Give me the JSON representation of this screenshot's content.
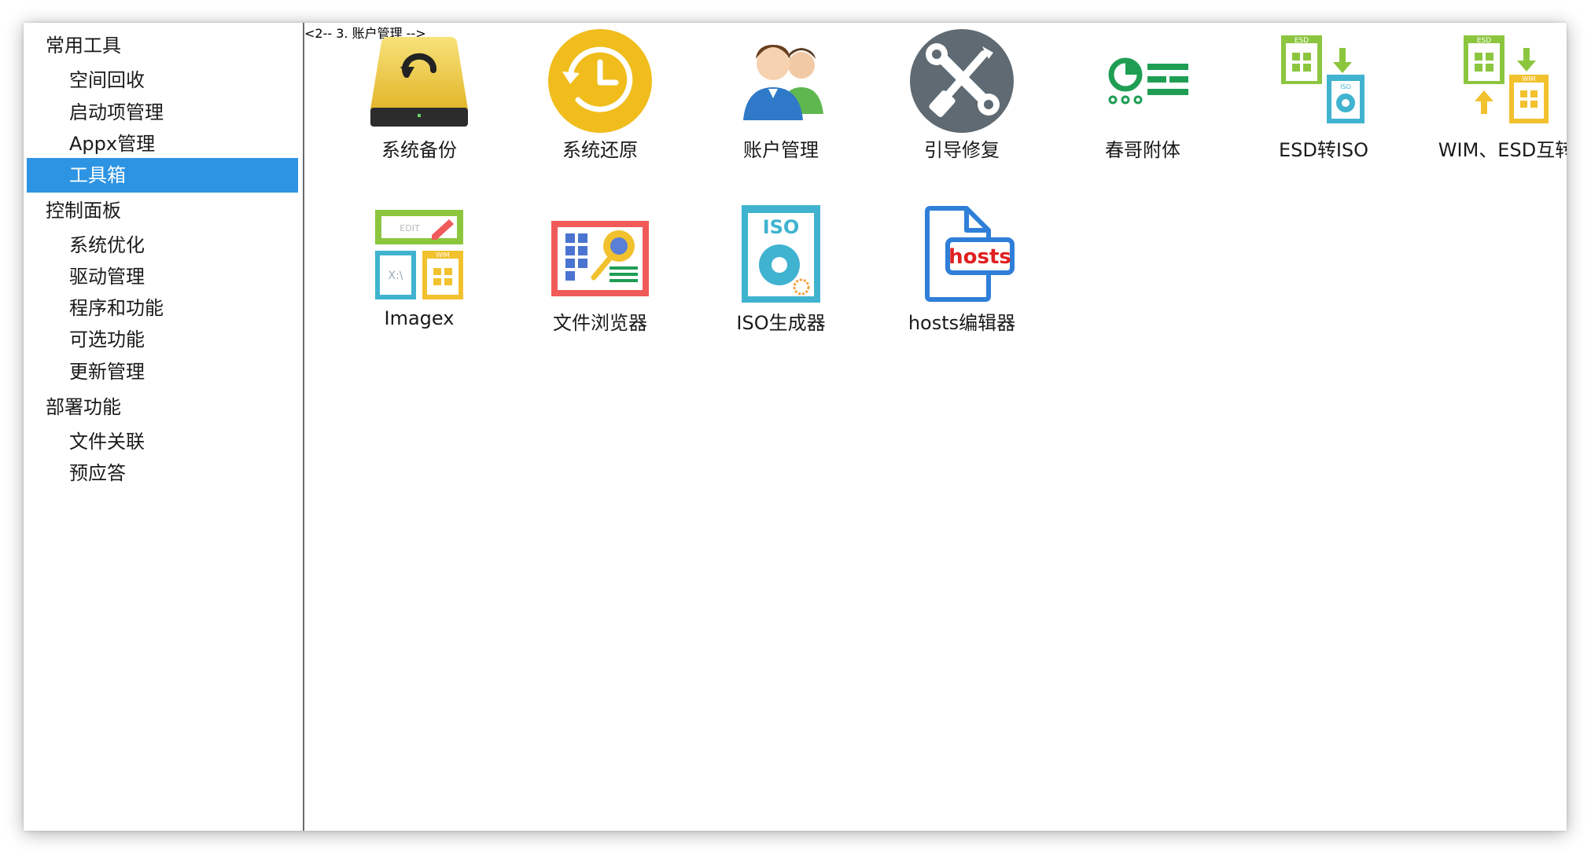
{
  "sidebar": {
    "groups": [
      {
        "title": "常用工具",
        "items": [
          {
            "label": "空间回收"
          },
          {
            "label": "启动项管理"
          },
          {
            "label": "Appx管理"
          },
          {
            "label": "工具箱",
            "selected": true
          }
        ]
      },
      {
        "title": "控制面板",
        "items": [
          {
            "label": "系统优化"
          },
          {
            "label": "驱动管理"
          },
          {
            "label": "程序和功能"
          },
          {
            "label": "可选功能"
          },
          {
            "label": "更新管理"
          }
        ]
      },
      {
        "title": "部署功能",
        "items": [
          {
            "label": "文件关联"
          },
          {
            "label": "预应答"
          }
        ]
      }
    ]
  },
  "tools": [
    {
      "label": "系统备份",
      "icon": "backup-drive-icon"
    },
    {
      "label": "系统还原",
      "icon": "restore-clock-icon"
    },
    {
      "label": "账户管理",
      "icon": "users-icon"
    },
    {
      "label": "引导修复",
      "icon": "wrench-screwdriver-icon"
    },
    {
      "label": "春哥附体",
      "icon": "toggle-settings-icon"
    },
    {
      "label": "ESD转ISO",
      "icon": "esd-to-iso-icon"
    },
    {
      "label": "WIM、ESD互转",
      "icon": "wim-esd-convert-icon"
    },
    {
      "label": "Imagex",
      "icon": "imagex-icon"
    },
    {
      "label": "文件浏览器",
      "icon": "file-browser-icon"
    },
    {
      "label": "ISO生成器",
      "icon": "iso-maker-icon"
    },
    {
      "label": "hosts编辑器",
      "icon": "hosts-file-icon"
    }
  ],
  "icon_text": {
    "esd": "ESD",
    "iso": "ISO",
    "wim": "WIM",
    "edit": "EDIT",
    "xa": "X:\\",
    "hosts": "hosts"
  },
  "colors": {
    "selection": "#2d94e3",
    "restore_yellow": "#f0bd1c",
    "wrench_gray": "#5f6a72",
    "toggle_green": "#1f9e53",
    "esd_green": "#8cc63f",
    "iso_teal": "#3fb3cf",
    "wim_yellow": "#f2c12e",
    "browser_red": "#f05a5a",
    "hosts_blue": "#2f7fd8",
    "hosts_red": "#e02020"
  }
}
